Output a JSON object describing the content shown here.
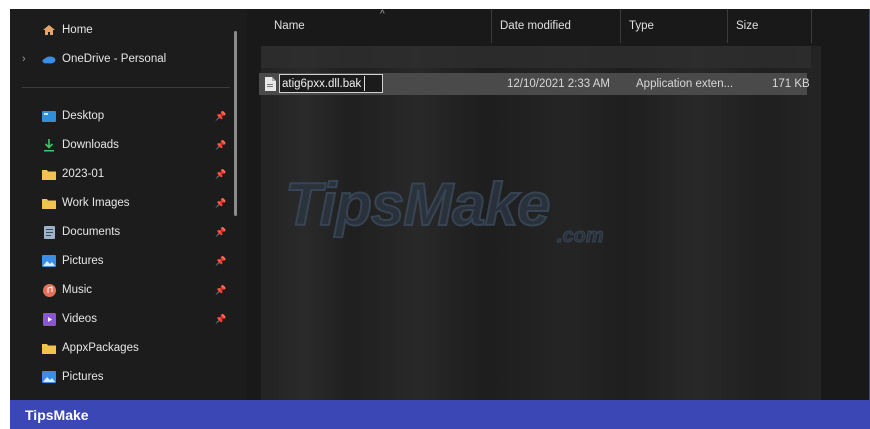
{
  "navigation": {
    "items": [
      {
        "label": "Home",
        "icon": "home-icon",
        "pinned": false
      },
      {
        "label": "OneDrive - Personal",
        "icon": "cloud-icon",
        "pinned": false,
        "expandable": true
      },
      {
        "label": "Desktop",
        "icon": "desktop-icon",
        "pinned": true
      },
      {
        "label": "Downloads",
        "icon": "download-icon",
        "pinned": true
      },
      {
        "label": "2023-01",
        "icon": "folder-icon",
        "pinned": true
      },
      {
        "label": "Work Images",
        "icon": "folder-icon",
        "pinned": true
      },
      {
        "label": "Documents",
        "icon": "document-icon",
        "pinned": true
      },
      {
        "label": "Pictures",
        "icon": "pictures-icon",
        "pinned": true
      },
      {
        "label": "Music",
        "icon": "music-icon",
        "pinned": true
      },
      {
        "label": "Videos",
        "icon": "video-icon",
        "pinned": true
      },
      {
        "label": "AppxPackages",
        "icon": "folder-icon",
        "pinned": false
      },
      {
        "label": "Pictures",
        "icon": "pictures-icon",
        "pinned": false
      }
    ]
  },
  "columns": {
    "name": "Name",
    "date_modified": "Date modified",
    "type": "Type",
    "size": "Size"
  },
  "selected_file": {
    "name": "atig6pxx.dll.bak",
    "date_modified": "12/10/2021 2:33 AM",
    "type": "Application exten...",
    "size": "171 KB"
  },
  "watermark": {
    "text": "TipsMake",
    "suffix": ".com"
  },
  "brand_bar": {
    "label": "TipsMake"
  },
  "colors": {
    "brand_bar": "#3a47b5",
    "background": "#191919",
    "selected_row": "#4a4a4a"
  }
}
